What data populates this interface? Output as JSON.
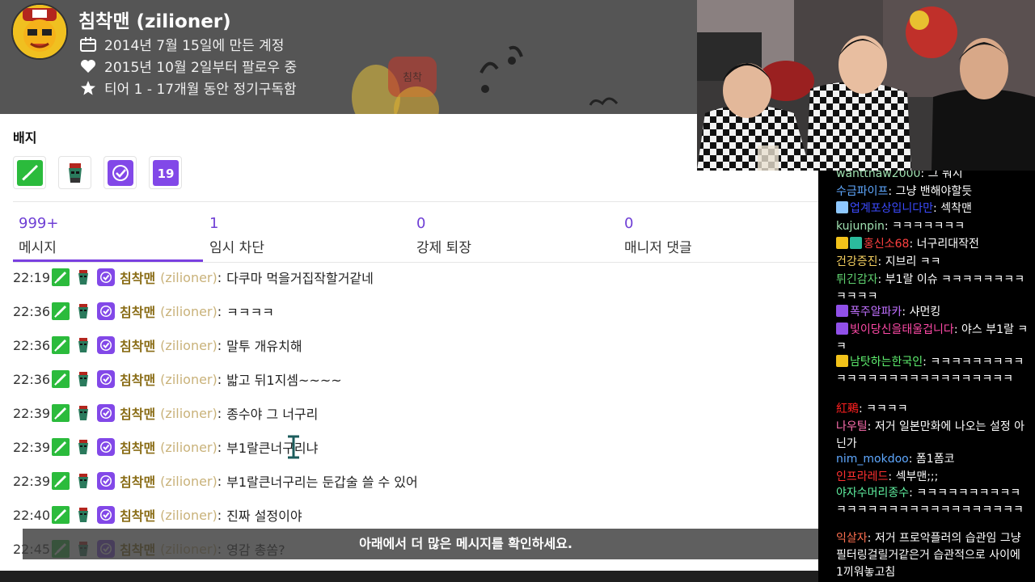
{
  "profile": {
    "username": "침착맨 (zilioner)",
    "created": "2014년 7월 15일에 만든 계정",
    "following": "2015년 10월 2일부터 팔로우 중",
    "tier": "티어 1 - 17개월 동안 정기구독함"
  },
  "badges": {
    "title": "배지",
    "items": [
      {
        "icon": "sword-badge-icon",
        "color": "#2bbb3c"
      },
      {
        "icon": "character-badge-icon",
        "color": "#2a7a5c"
      },
      {
        "icon": "verified-check-badge-icon",
        "color": "#8248e8"
      },
      {
        "icon": "age-19-badge-icon",
        "color": "#8248e8",
        "label": "19"
      }
    ]
  },
  "stats": {
    "messages": {
      "count": "999+",
      "label": "메시지"
    },
    "timeouts": {
      "count": "1",
      "label": "임시 차단"
    },
    "bans": {
      "count": "0",
      "label": "강제 퇴장"
    },
    "mod_comments": {
      "count": "0",
      "label": "매니저 댓글"
    }
  },
  "messages": [
    {
      "time": "22:19",
      "name": "침착맨",
      "login": "(zilioner)",
      "colon": ":",
      "text": "다쿠마 먹을거집작할거같네"
    },
    {
      "time": "22:36",
      "name": "침착맨",
      "login": "(zilioner)",
      "colon": ":",
      "text": "ㅋㅋㅋㅋ"
    },
    {
      "time": "22:36",
      "name": "침착맨",
      "login": "(zilioner)",
      "colon": ":",
      "text": "말투 개유치해"
    },
    {
      "time": "22:36",
      "name": "침착맨",
      "login": "(zilioner)",
      "colon": ":",
      "text": "밟고 뒤1지셈~~~~"
    },
    {
      "time": "22:39",
      "name": "침착맨",
      "login": "(zilioner)",
      "colon": ":",
      "text": "종수야 그 너구리"
    },
    {
      "time": "22:39",
      "name": "침착맨",
      "login": "(zilioner)",
      "colon": ":",
      "text": "부1랄큰너구리냐"
    },
    {
      "time": "22:39",
      "name": "침착맨",
      "login": "(zilioner)",
      "colon": ":",
      "text": "부1랄큰너구리는 둔갑술 쓸 수 있어"
    },
    {
      "time": "22:40",
      "name": "침착맨",
      "login": "(zilioner)",
      "colon": ":",
      "text": "진짜 설정이야"
    },
    {
      "time": "22:45",
      "name": "침착맨",
      "login": "(zilioner)",
      "colon": ":",
      "text": "영감 총쏨?"
    }
  ],
  "more_banner": "아래에서 더 많은 메시지를 확인하세요.",
  "chat": [
    {
      "user": "wanttnaw2000",
      "color": "#9fe0b0",
      "text": "그 뭐지",
      "badges": []
    },
    {
      "user": "수금파이프",
      "color": "#5fa8ff",
      "text": "그냥 밴해야할듯",
      "badges": []
    },
    {
      "user": "업계포상입니다만",
      "color": "#3c4bff",
      "text": "섹착맨",
      "badges": [
        "#8ec8ff"
      ]
    },
    {
      "user": "kujunpin",
      "color": "#9fe0b0",
      "text": "ㅋㅋㅋㅋㅋㅋㅋ",
      "badges": []
    },
    {
      "user": "홍신소68",
      "color": "#ff4040",
      "text": "너구리대작전",
      "badges": [
        "#f2c21a",
        "#2bbb9c"
      ]
    },
    {
      "user": "건강증진",
      "color": "#f5d060",
      "text": "지브리 ㅋㅋ",
      "badges": []
    },
    {
      "user": "튀긴감자",
      "color": "#5fd06f",
      "text": "부1랄 이슈 ㅋㅋㅋㅋㅋㅋㅋㅋㅋㅋㅋㅋ",
      "badges": []
    },
    {
      "user": "폭주알파카",
      "color": "#c070ff",
      "text": "샤먼킹",
      "badges": [
        "#9050e8"
      ]
    },
    {
      "user": "빛이당신을태울겁니다",
      "color": "#ff4aa8",
      "text": "야스 부1랄 ㅋㅋ",
      "badges": [
        "#9050e8"
      ]
    },
    {
      "user": "남탓하는한국인",
      "color": "#5ff06f",
      "text": "ㅋㅋㅋㅋㅋㅋㅋㅋㅋㅋㅋㅋㅋㅋㅋㅋㅋㅋㅋㅋㅋㅋㅋㅋㅋㅋ",
      "badges": [
        "#f2c21a"
      ]
    },
    {
      "user": "紅鵐",
      "color": "#ff2020",
      "text": "ㅋㅋㅋㅋ",
      "badges": []
    },
    {
      "user": "나우틸",
      "color": "#ff6fb0",
      "text": "저거 일본만화에 나오는 설정 아닌가",
      "badges": []
    },
    {
      "user": "nim_mokdoo",
      "color": "#5fa8ff",
      "text": "폼1폼코",
      "badges": []
    },
    {
      "user": "인프라레드",
      "color": "#ff3030",
      "text": "섹부맨;;;",
      "badges": []
    },
    {
      "user": "야자수머리종수",
      "color": "#5ff0a0",
      "text": "ㅋㅋㅋㅋㅋㅋㅋㅋㅋㅋㅋㅋㅋㅋㅋㅋㅋㅋㅋㅋㅋㅋㅋㅋㅋㅋㅋㅋ",
      "badges": []
    },
    {
      "user": "익살자",
      "color": "#ff7050",
      "text": "저거 프로악플러의 습관임 그냥 필터링걸릴거같은거 습관적으로 사이에 1끼워놓고침",
      "badges": []
    }
  ]
}
